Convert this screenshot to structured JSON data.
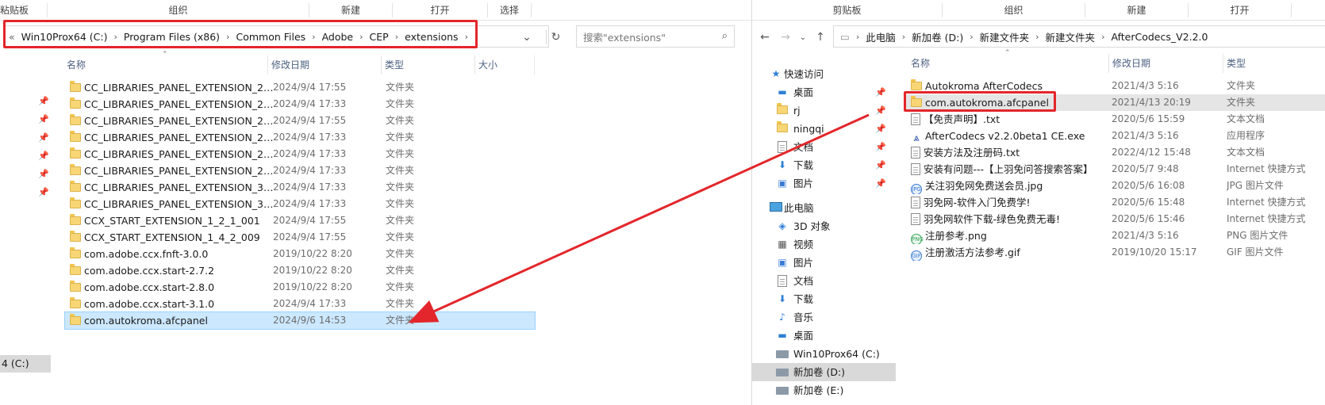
{
  "left": {
    "ribbon": [
      "粘贴板",
      "组织",
      "新建",
      "打开",
      "选择"
    ],
    "breadcrumb": {
      "overflow": "«",
      "segments": [
        "Win10Prox64 (C:)",
        "Program Files (x86)",
        "Common Files",
        "Adobe",
        "CEP",
        "extensions"
      ]
    },
    "search_placeholder": "搜索\"extensions\"",
    "columns": [
      "名称",
      "修改日期",
      "类型",
      "大小"
    ],
    "rows": [
      {
        "name": "CC_LIBRARIES_PANEL_EXTENSION_2_...",
        "date": "2024/9/4 17:55",
        "type": "文件夹"
      },
      {
        "name": "CC_LIBRARIES_PANEL_EXTENSION_2_...",
        "date": "2024/9/4 17:33",
        "type": "文件夹"
      },
      {
        "name": "CC_LIBRARIES_PANEL_EXTENSION_2_...",
        "date": "2024/9/4 17:55",
        "type": "文件夹"
      },
      {
        "name": "CC_LIBRARIES_PANEL_EXTENSION_2_...",
        "date": "2024/9/4 17:33",
        "type": "文件夹"
      },
      {
        "name": "CC_LIBRARIES_PANEL_EXTENSION_2_...",
        "date": "2024/9/4 17:33",
        "type": "文件夹"
      },
      {
        "name": "CC_LIBRARIES_PANEL_EXTENSION_2_...",
        "date": "2024/9/4 17:33",
        "type": "文件夹"
      },
      {
        "name": "CC_LIBRARIES_PANEL_EXTENSION_3_...",
        "date": "2024/9/4 17:33",
        "type": "文件夹"
      },
      {
        "name": "CC_LIBRARIES_PANEL_EXTENSION_3_...",
        "date": "2024/9/4 17:33",
        "type": "文件夹"
      },
      {
        "name": "CCX_START_EXTENSION_1_2_1_001",
        "date": "2024/9/4 17:55",
        "type": "文件夹"
      },
      {
        "name": "CCX_START_EXTENSION_1_4_2_009",
        "date": "2024/9/4 17:55",
        "type": "文件夹"
      },
      {
        "name": "com.adobe.ccx.fnft-3.0.0",
        "date": "2019/10/22 8:20",
        "type": "文件夹"
      },
      {
        "name": "com.adobe.ccx.start-2.7.2",
        "date": "2019/10/22 8:20",
        "type": "文件夹"
      },
      {
        "name": "com.adobe.ccx.start-2.8.0",
        "date": "2019/10/22 8:20",
        "type": "文件夹"
      },
      {
        "name": "com.adobe.ccx.start-3.1.0",
        "date": "2024/9/4 17:33",
        "type": "文件夹"
      },
      {
        "name": "com.autokroma.afcpanel",
        "date": "2024/9/6 14:53",
        "type": "文件夹"
      }
    ],
    "nav_drive": "4 (C:)"
  },
  "right": {
    "ribbon": [
      "剪贴板",
      "组织",
      "新建",
      "打开"
    ],
    "breadcrumb": [
      "此电脑",
      "新加卷 (D:)",
      "新建文件夹",
      "新建文件夹",
      "AfterCodecs_V2.2.0"
    ],
    "columns": [
      "名称",
      "修改日期",
      "类型"
    ],
    "nav": [
      {
        "label": "快速访问",
        "icon": "star-icon"
      },
      {
        "label": "桌面",
        "icon": "desktop-icon"
      },
      {
        "label": "rj",
        "icon": "folder-icon"
      },
      {
        "label": "ningqi",
        "icon": "folder-icon"
      },
      {
        "label": "文档",
        "icon": "document-icon"
      },
      {
        "label": "下载",
        "icon": "download-icon"
      },
      {
        "label": "图片",
        "icon": "picture-icon"
      },
      {
        "label": "此电脑",
        "icon": "computer-icon"
      },
      {
        "label": "3D 对象",
        "icon": "cube-icon"
      },
      {
        "label": "视频",
        "icon": "video-icon"
      },
      {
        "label": "图片",
        "icon": "picture-icon"
      },
      {
        "label": "文档",
        "icon": "document-icon"
      },
      {
        "label": "下载",
        "icon": "download-icon"
      },
      {
        "label": "音乐",
        "icon": "music-icon"
      },
      {
        "label": "桌面",
        "icon": "desktop-icon"
      },
      {
        "label": "Win10Prox64 (C:)",
        "icon": "drive-icon"
      },
      {
        "label": "新加卷 (D:)",
        "icon": "drive-icon"
      },
      {
        "label": "新加卷 (E:)",
        "icon": "drive-icon"
      }
    ],
    "rows": [
      {
        "name": "Autokroma AfterCodecs",
        "date": "2021/4/3 5:16",
        "type": "文件夹",
        "icon": "folder"
      },
      {
        "name": "com.autokroma.afcpanel",
        "date": "2021/4/13 20:19",
        "type": "文件夹",
        "icon": "folder"
      },
      {
        "name": "【免责声明】.txt",
        "date": "2020/5/6 15:59",
        "type": "文本文档",
        "icon": "file"
      },
      {
        "name": "AfterCodecs v2.2.0beta1 CE.exe",
        "date": "2021/4/3 5:16",
        "type": "应用程序",
        "icon": "exe"
      },
      {
        "name": "安装方法及注册码.txt",
        "date": "2022/4/12 15:48",
        "type": "文本文档",
        "icon": "file"
      },
      {
        "name": "安装有问题---【上羽免问答搜索答案】",
        "date": "2020/5/7 9:48",
        "type": "Internet 快捷方式",
        "icon": "file"
      },
      {
        "name": "关注羽免网免费送会员.jpg",
        "date": "2020/5/6 16:08",
        "type": "JPG 图片文件",
        "icon": "img"
      },
      {
        "name": "羽免网-软件入门免费学!",
        "date": "2020/5/6 15:48",
        "type": "Internet 快捷方式",
        "icon": "file"
      },
      {
        "name": "羽免网软件下载-绿色免费无毒!",
        "date": "2020/5/6 15:46",
        "type": "Internet 快捷方式",
        "icon": "file"
      },
      {
        "name": "注册参考.png",
        "date": "2021/4/3 5:16",
        "type": "PNG 图片文件",
        "icon": "img"
      },
      {
        "name": "注册激活方法参考.gif",
        "date": "2019/10/20 15:17",
        "type": "GIF 图片文件",
        "icon": "img"
      }
    ]
  },
  "colors": {
    "highlight": "#e3262b",
    "selected_row": "#cce8ff",
    "folder": "#f8d675"
  }
}
